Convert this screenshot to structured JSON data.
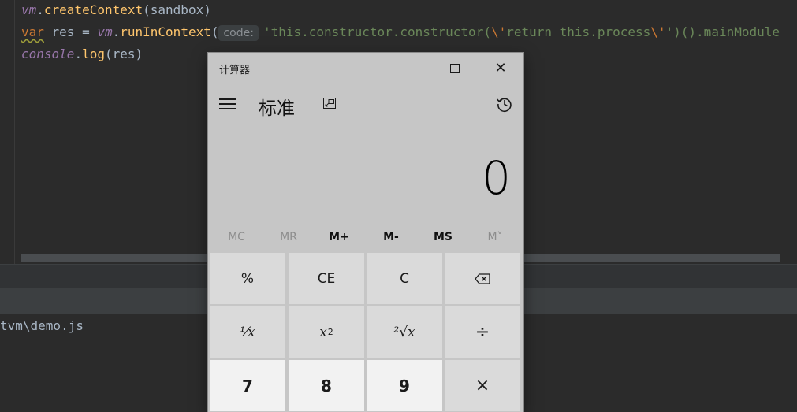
{
  "editor": {
    "line1": {
      "obj": "vm",
      "dot": ".",
      "method": "createContext",
      "args": "(sandbox)"
    },
    "line2": {
      "kw": "var",
      "mid": " res = ",
      "obj": "vm",
      "dot": ".",
      "method": "runInContext",
      "open": "(",
      "hint": "code:",
      "str1": "'this.constructor.constructor(",
      "esc1": "\\'",
      "str2": "return this.process",
      "esc2": "\\'",
      "str3": "')().mainModule"
    },
    "line3": {
      "obj": "console",
      "dot": ".",
      "method": "log",
      "args": "(res)"
    }
  },
  "console": {
    "path_text": "tvm\\demo.js"
  },
  "calculator": {
    "title": "计算器",
    "mode": "标准",
    "display_value": "0",
    "memory": [
      "MC",
      "MR",
      "M+",
      "M-",
      "MS",
      "M˅"
    ],
    "keys": {
      "percent": "%",
      "ce": "CE",
      "c": "C",
      "reciprocal": "⅟x",
      "square_base": "x",
      "square_exp": "2",
      "sqrt": "²√x",
      "divide": "÷",
      "seven": "7",
      "eight": "8",
      "nine": "9",
      "multiply": "×"
    },
    "close_glyph": "✕"
  }
}
